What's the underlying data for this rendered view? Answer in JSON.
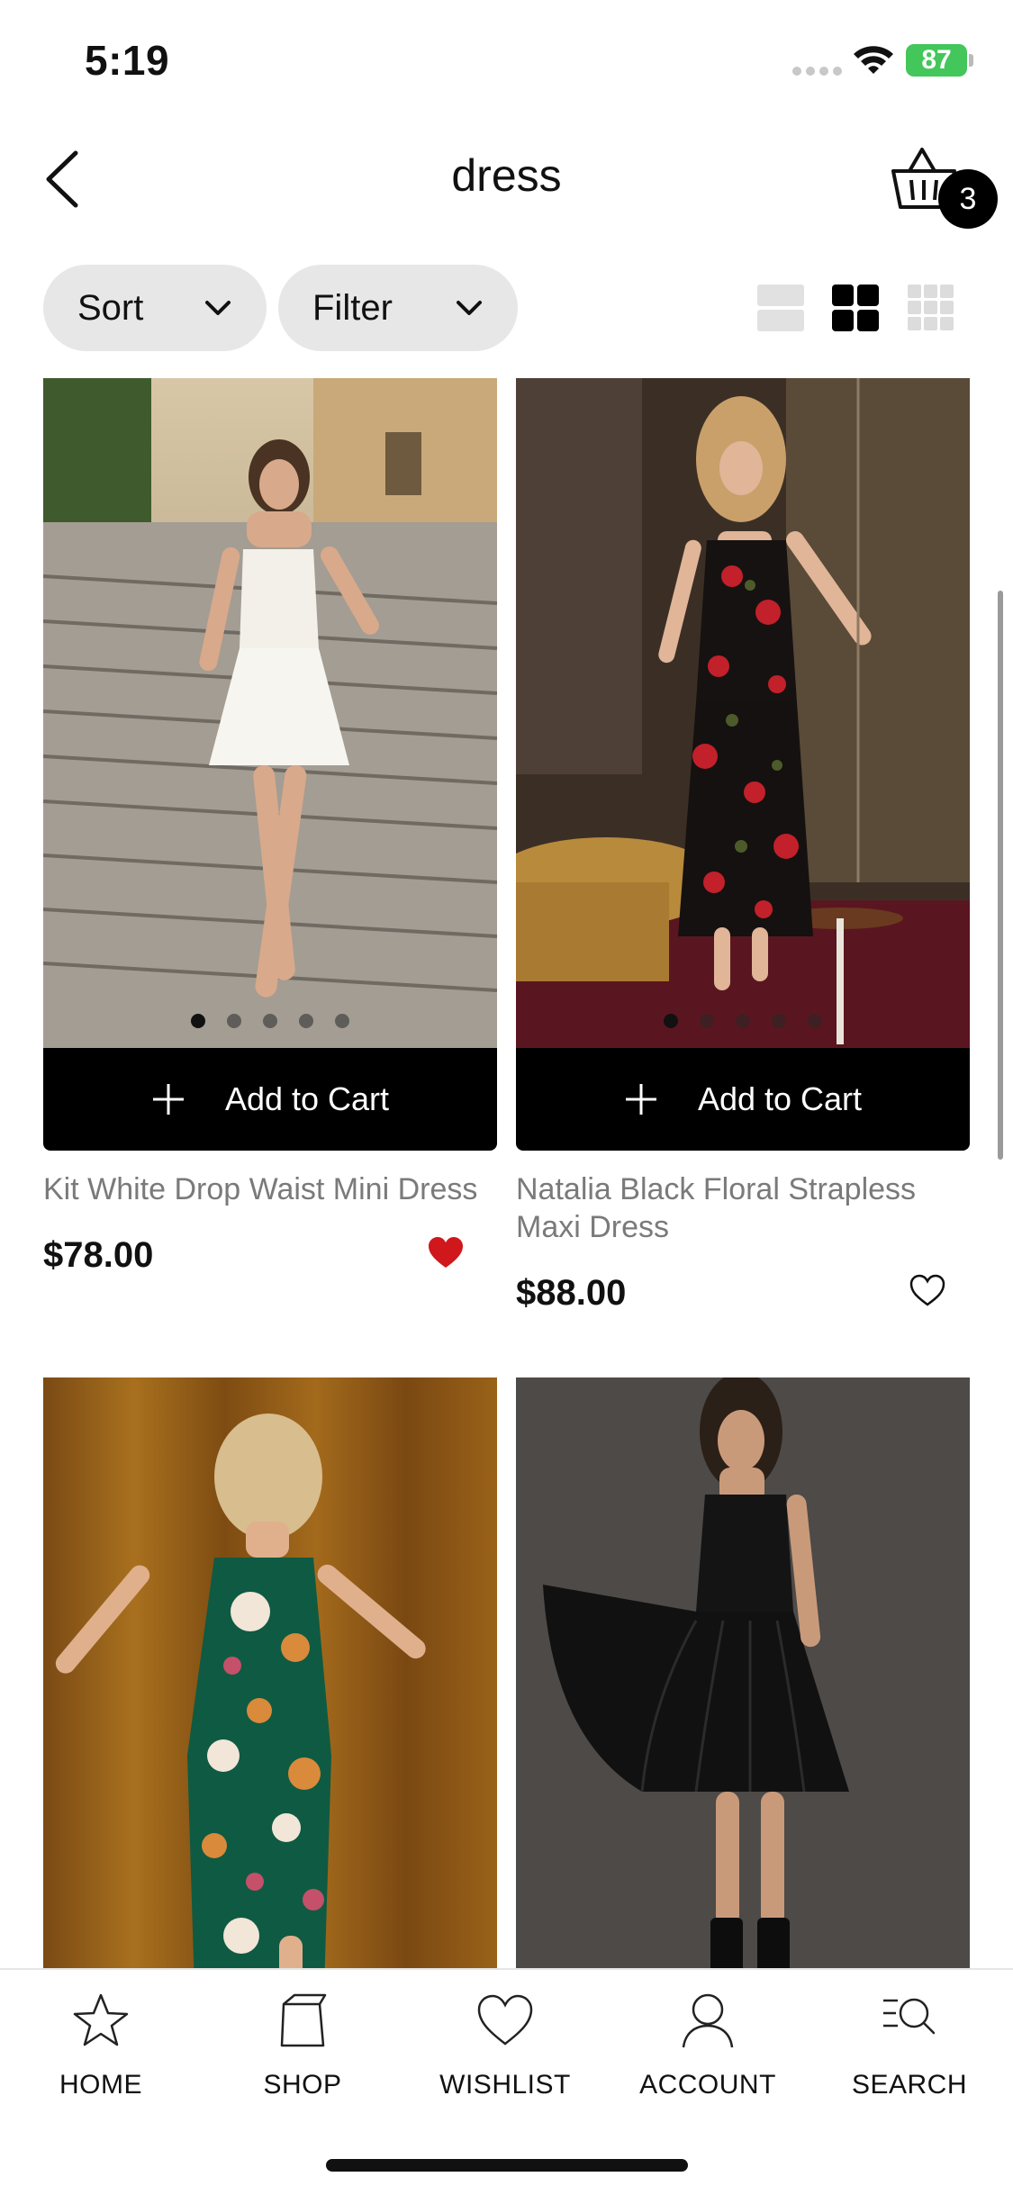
{
  "status_bar": {
    "time": "5:19",
    "battery": "87"
  },
  "header": {
    "title": "dress",
    "cart_count": "3"
  },
  "toolbar": {
    "sort_label": "Sort",
    "filter_label": "Filter",
    "active_view": "grid-2"
  },
  "products": [
    {
      "name": "Kit White Drop Waist Mini Dress",
      "price": "$78.00",
      "add_label": "Add to Cart",
      "wishlisted": true
    },
    {
      "name": "Natalia Black Floral Strapless Maxi Dress",
      "price": "$88.00",
      "add_label": "Add to Cart",
      "wishlisted": false
    },
    {
      "name": "",
      "price": "",
      "add_label": "",
      "wishlisted": false
    },
    {
      "name": "",
      "price": "",
      "add_label": "",
      "wishlisted": false
    }
  ],
  "nav": {
    "items": [
      {
        "label": "HOME",
        "icon": "star-icon"
      },
      {
        "label": "SHOP",
        "icon": "shopping-bag-icon"
      },
      {
        "label": "WISHLIST",
        "icon": "heart-icon"
      },
      {
        "label": "ACCOUNT",
        "icon": "person-icon"
      },
      {
        "label": "SEARCH",
        "icon": "search-list-icon"
      }
    ]
  },
  "colors": {
    "accent": "#000000",
    "wishlist_active": "#d0171c",
    "pill_bg": "#e7e7e7"
  }
}
